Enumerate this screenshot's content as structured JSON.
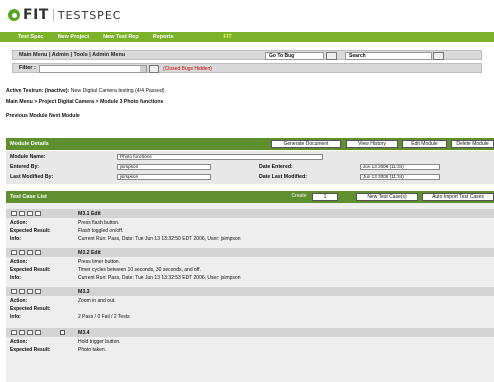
{
  "logo": {
    "fit": "FIT",
    "product": "TESTSPEC"
  },
  "topnav": [
    "Test Spec",
    "New Project",
    "New Test Rep",
    "Reports",
    "FIT"
  ],
  "toolbar": {
    "crumbs": "Main Menu  |  Admin  |  Tools  |  Admin Menu",
    "goto": "Go To Bug",
    "search": "Search",
    "filter_label": "Filter :",
    "closed_link": "(Closed Bugs Hidden)"
  },
  "info": {
    "tester_label": "Active Testrun: (inactive):",
    "tester_value": "New Digital Camera testing (4/4 Passed)",
    "breadcrumb": "Main Menu > Project Digital Camera > Module 3 Photo functions",
    "previous": "Previous Module  Next Module"
  },
  "module_details": {
    "title": "Module Details",
    "buttons": [
      "Generate Document",
      "View History",
      "Edit Module",
      "Delete Module"
    ],
    "name_label": "Module Name:",
    "name_value": "Photo functions",
    "entered_by_label": "Entered By:",
    "entered_by_value": "jsimpson",
    "modified_by_label": "Last Modified By:",
    "modified_by_value": "jsimpson",
    "date_entered_label": "Date Entered:",
    "date_entered_value": "Jun 13 2006 (11:34)",
    "date_modified_label": "Date Last Modified:",
    "date_modified_value": "Jun 13 2006 (11:34)"
  },
  "test_cases": {
    "title": "Test Case List",
    "create_label": "Create",
    "create_value": "1",
    "new_button": "New Test Case(s)",
    "import_button": "Auto Import Test Cases",
    "action_label": "Action:",
    "expected_label": "Expected Result:",
    "info_label": "Info:",
    "items": [
      {
        "name": "M3.1 Edit",
        "action": "Press flash button.",
        "expected": "Flash toggled on/off.",
        "info": "Current Run: Pass, Date: Tue Jun 13 13:32:50 EDT 2006, User: jsimpson"
      },
      {
        "name": "M3.2 Edit",
        "action": "Press timer button.",
        "expected": "Timer cycles between 10 seconds, 30 seconds, and off.",
        "info": "Current Run: Pass, Date: Tue Jun 13 13:32:53 EDT 2006, User: jsimpson"
      },
      {
        "name": "M3.3",
        "action": "Zoom in and out.",
        "expected": "",
        "info": "2 Pass / 0 Fail / 2 Tests"
      },
      {
        "name": "M3.4",
        "action": "Hold trigger button.",
        "expected": "Photo taken.",
        "info": ""
      }
    ]
  }
}
